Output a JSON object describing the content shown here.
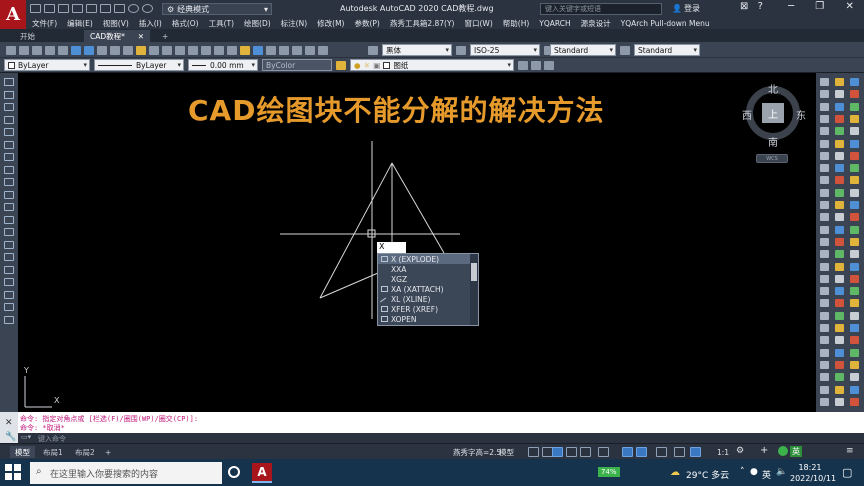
{
  "app": {
    "logo": "A",
    "workspace": "经典模式",
    "window_title": "Autodesk AutoCAD 2020    CAD教程.dwg",
    "search_placeholder": "键入关键字或短语",
    "login": "登录"
  },
  "menu": [
    "文件(F)",
    "编辑(E)",
    "视图(V)",
    "插入(I)",
    "格式(O)",
    "工具(T)",
    "绘图(D)",
    "标注(N)",
    "修改(M)",
    "参数(P)",
    "燕秀工具箱2.87(Y)",
    "窗口(W)",
    "帮助(H)",
    "YQARCH",
    "源泉设计",
    "YQArch Pull-down Menu"
  ],
  "tabs": [
    {
      "label": "开始",
      "active": false
    },
    {
      "label": "CAD教程*",
      "active": true
    }
  ],
  "toolbar": {
    "font": "黑体",
    "dimstyle": "ISO-25",
    "tablestyle": "Standard",
    "mlstyle": "Standard",
    "layer_color": "ByLayer",
    "linetype": "ByLayer",
    "lineweight": "0.00 mm",
    "plotstyle": "ByColor",
    "layer_name": "图纸"
  },
  "heading": "CAD绘图块不能分解的解决方法",
  "viewcube": {
    "north": "北",
    "west": "西",
    "east": "东",
    "south": "南",
    "face": "上",
    "wcs": "WCS"
  },
  "command_input": "X",
  "autocomplete": [
    {
      "label": "X (EXPLODE)",
      "selected": true,
      "icon": "explode-icon"
    },
    {
      "label": "XXA",
      "selected": false,
      "icon": ""
    },
    {
      "label": "XGZ",
      "selected": false,
      "icon": ""
    },
    {
      "label": "XA (XATTACH)",
      "selected": false,
      "icon": "xattach-icon"
    },
    {
      "label": "XL (XLINE)",
      "selected": false,
      "icon": "xline-icon"
    },
    {
      "label": "XFER (XREF)",
      "selected": false,
      "icon": "xref-icon"
    },
    {
      "label": "XOPEN",
      "selected": false,
      "icon": "xopen-icon"
    }
  ],
  "ucs": {
    "y": "Y",
    "x": "X"
  },
  "command_history": [
    "命令: 指定对角点或 [栏选(F)/圈围(WP)/圈交(CP)]:",
    "命令: *取消*"
  ],
  "command_prompt": "键入命令",
  "layouts": [
    {
      "label": "模型",
      "active": true
    },
    {
      "label": "布局1",
      "active": false
    },
    {
      "label": "布局2",
      "active": false
    }
  ],
  "status": {
    "text_height": "燕秀字高=2.5",
    "model": "模型",
    "scale": "1:1"
  },
  "taskbar": {
    "search": "在这里输入你要搜索的内容",
    "battery": "74%",
    "weather": "29°C 多云",
    "ime": "英",
    "time": "18:21",
    "date": "2022/10/11"
  }
}
